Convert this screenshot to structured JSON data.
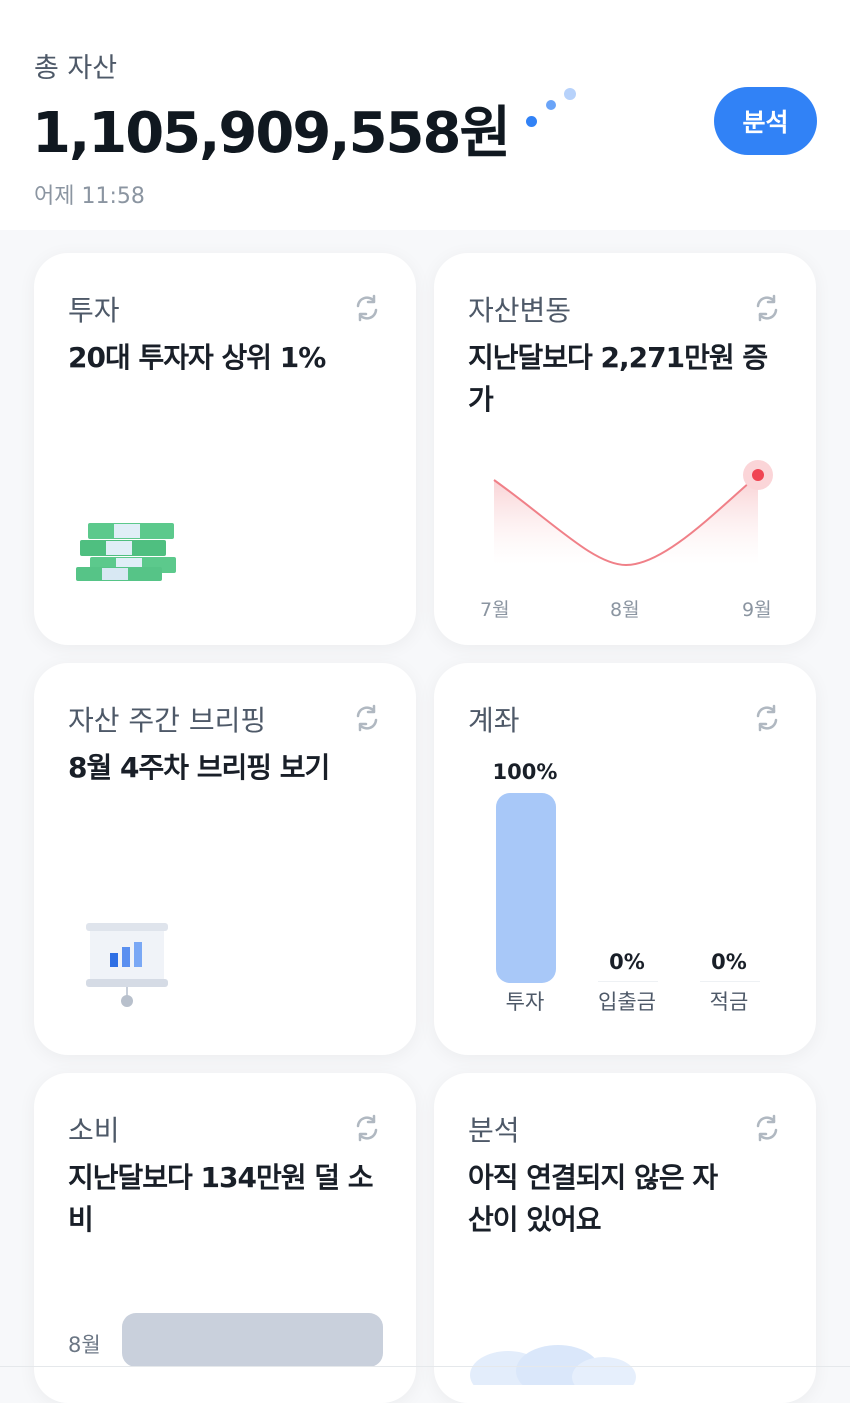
{
  "summary": {
    "total_label": "총 자산",
    "total_value": "1,105,909,558원",
    "updated": "어제 11:58",
    "analysis_button": "분석"
  },
  "cards": {
    "invest": {
      "title": "투자",
      "headline": "20대 투자자 상위 1%"
    },
    "asset_change": {
      "title": "자산변동",
      "headline": "지난달보다 2,271만원 증가",
      "months": [
        "7월",
        "8월",
        "9월"
      ]
    },
    "briefing": {
      "title": "자산 주간 브리핑",
      "headline": "8월 4주차 브리핑 보기"
    },
    "account": {
      "title": "계좌",
      "bars": [
        {
          "name": "투자",
          "percent": "100%",
          "value": 100
        },
        {
          "name": "입출금",
          "percent": "0%",
          "value": 0
        },
        {
          "name": "적금",
          "percent": "0%",
          "value": 0
        }
      ]
    },
    "spending": {
      "title": "소비",
      "headline": "지난달보다 134만원 덜 소비",
      "month": "8월"
    },
    "analysis": {
      "title": "분석",
      "headline": "아직 연결되지 않은 자산이 있어요"
    }
  },
  "colors": {
    "accent": "#3182f6",
    "line_red": "#f04452",
    "bar_blue": "#a8c8f8",
    "money_green": "#5cc98c"
  }
}
